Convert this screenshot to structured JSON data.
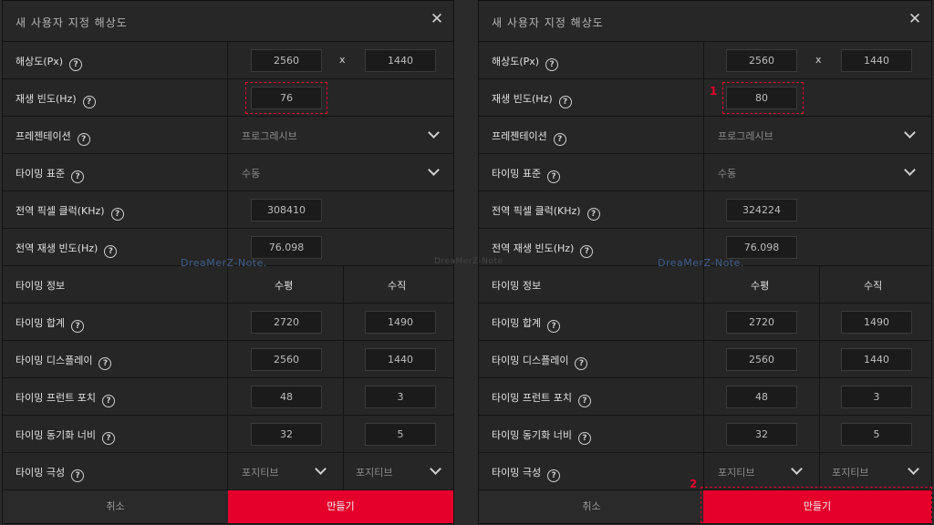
{
  "watermark": {
    "main": "DreaMerZ-Note.",
    "center": "DreaMerZ-Note"
  },
  "left": {
    "title": "새 사용자 지정 해상도",
    "resolution": {
      "label": "해상도(Px)",
      "width": "2560",
      "sep": "x",
      "height": "1440"
    },
    "refresh": {
      "label": "재생 빈도(Hz)",
      "value": "76"
    },
    "presentation": {
      "label": "프레젠테이션",
      "value": "프로그레시브"
    },
    "timing_std": {
      "label": "타이밍 표준",
      "value": "수동"
    },
    "pixel_clock": {
      "label": "전역 픽셀 클럭(KHz)",
      "value": "308410"
    },
    "global_refresh": {
      "label": "전역 재생 빈도(Hz)",
      "value": "76.098"
    },
    "timing_info": {
      "label": "타이밍 정보",
      "h": "수평",
      "v": "수직"
    },
    "total": {
      "label": "타이밍 합계",
      "h": "2720",
      "v": "1490"
    },
    "display": {
      "label": "타이밍 디스플레이",
      "h": "2560",
      "v": "1440"
    },
    "front_porch": {
      "label": "타이밍 프런트 포치",
      "h": "48",
      "v": "3"
    },
    "sync_width": {
      "label": "타이밍 동기화 너비",
      "h": "32",
      "v": "5"
    },
    "polarity": {
      "label": "타이밍 극성",
      "h": "포지티브",
      "v": "포지티브"
    },
    "cancel": "취소",
    "create": "만들기"
  },
  "right": {
    "title": "새 사용자 지정 해상도",
    "resolution": {
      "label": "해상도(Px)",
      "width": "2560",
      "sep": "x",
      "height": "1440"
    },
    "refresh": {
      "label": "재생 빈도(Hz)",
      "value": "80"
    },
    "presentation": {
      "label": "프레젠테이션",
      "value": "프로그레시브"
    },
    "timing_std": {
      "label": "타이밍 표준",
      "value": "수동"
    },
    "pixel_clock": {
      "label": "전역 픽셀 클럭(KHz)",
      "value": "324224"
    },
    "global_refresh": {
      "label": "전역 재생 빈도(Hz)",
      "value": "76.098"
    },
    "timing_info": {
      "label": "타이밍 정보",
      "h": "수평",
      "v": "수직"
    },
    "total": {
      "label": "타이밍 합계",
      "h": "2720",
      "v": "1490"
    },
    "display": {
      "label": "타이밍 디스플레이",
      "h": "2560",
      "v": "1440"
    },
    "front_porch": {
      "label": "타이밍 프런트 포치",
      "h": "48",
      "v": "3"
    },
    "sync_width": {
      "label": "타이밍 동기화 너비",
      "h": "32",
      "v": "5"
    },
    "polarity": {
      "label": "타이밍 극성",
      "h": "포지티브",
      "v": "포지티브"
    },
    "cancel": "취소",
    "create": "만들기",
    "badge1": "1",
    "badge2": "2"
  },
  "colors": {
    "accent": "#e4002b",
    "bg": "#232323",
    "field": "#1b1b1b"
  }
}
